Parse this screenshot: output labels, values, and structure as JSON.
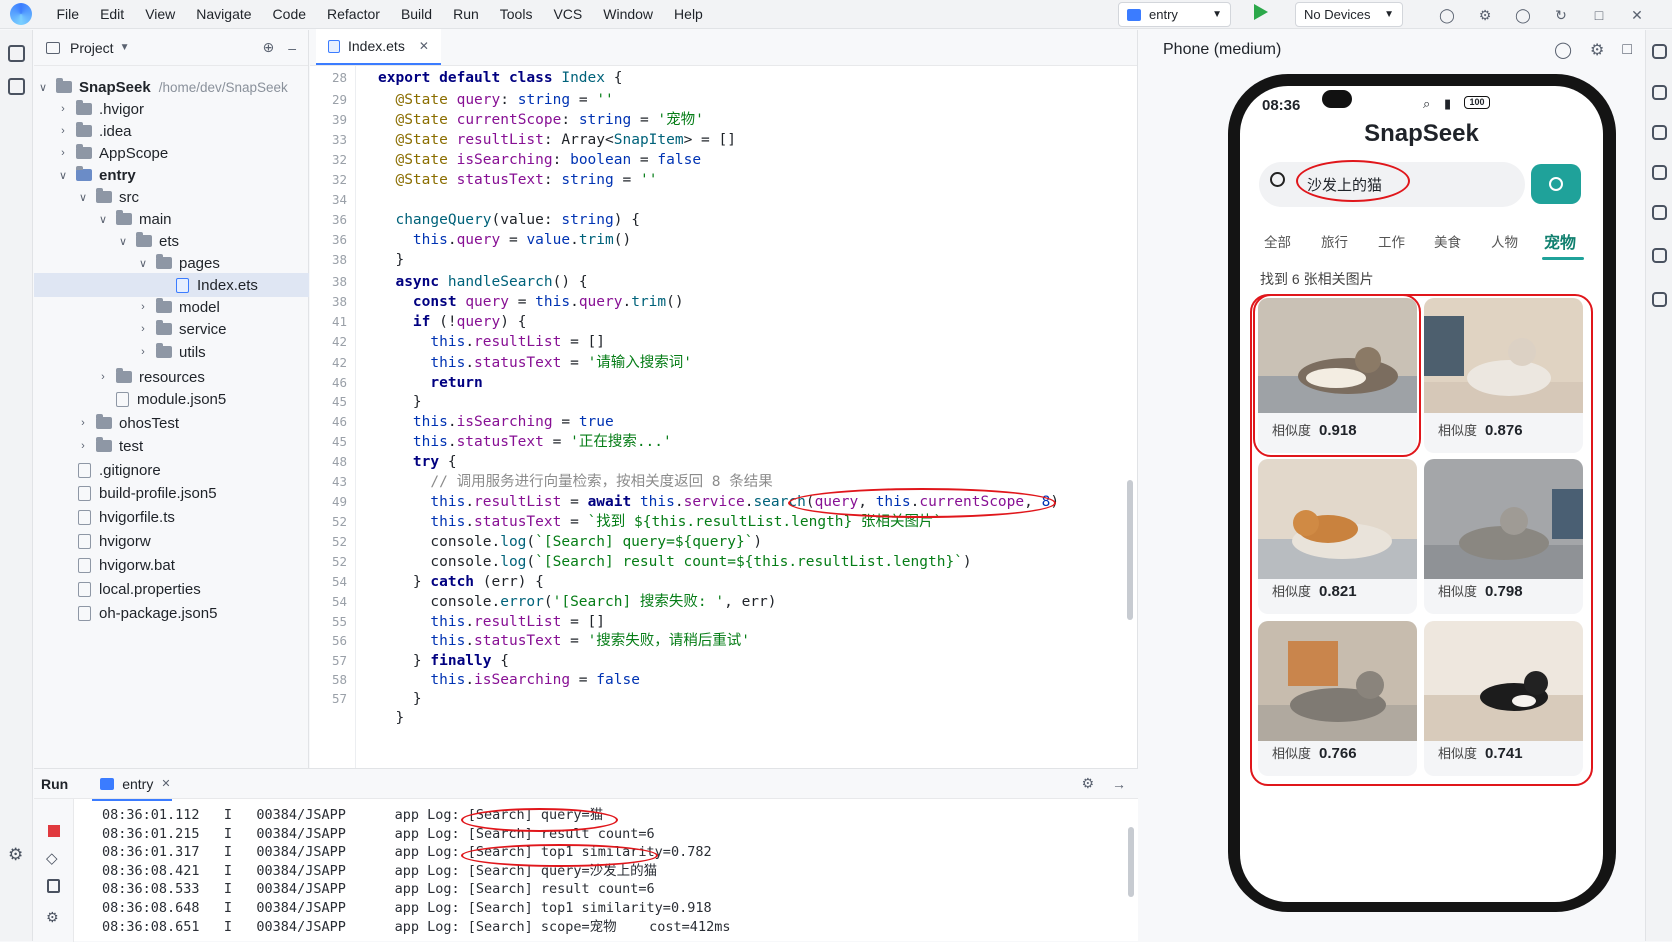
{
  "menu": [
    "File",
    "Edit",
    "View",
    "Navigate",
    "Code",
    "Refactor",
    "Build",
    "Run",
    "Tools",
    "VCS",
    "Window",
    "Help"
  ],
  "toolbar": {
    "run_config": "entry",
    "device": "No Devices"
  },
  "project": {
    "header": "Project",
    "root_name": "SnapSeek",
    "root_path": "/home/dev/SnapSeek",
    "items": [
      ".hvigor",
      ".idea",
      "AppScope",
      "entry",
      "src",
      "main",
      "ets",
      "pages",
      "Index.ets",
      "model",
      "service",
      "utils",
      "resources",
      "module.json5",
      "ohosTest",
      "test",
      ".gitignore",
      "build-profile.json5",
      "hvigorfile.ts",
      "hvigorw",
      "hvigorw.bat",
      "local.properties",
      "oh-package.json5"
    ]
  },
  "editor": {
    "tab": "Index.ets",
    "line_numbers": [
      "28",
      "29",
      "39",
      "33",
      "32",
      "32",
      "34",
      "36",
      "36",
      "38",
      "38",
      "38",
      "41",
      "42",
      "42",
      "46",
      "45",
      "46",
      "45",
      "48",
      "43",
      "49",
      "52",
      "52",
      "52",
      "54",
      "54",
      "55",
      "56",
      "57",
      "58",
      "57"
    ]
  },
  "run": {
    "title": "Run",
    "tab": "entry",
    "logs": [
      {
        "time": "08:36:01.112",
        "lvl": "I",
        "tag": "00384/JSAPP",
        "msg": "app Log: [Search] query=猫"
      },
      {
        "time": "08:36:01.215",
        "lvl": "I",
        "tag": "00384/JSAPP",
        "msg": "app Log: [Search] result count=6"
      },
      {
        "time": "08:36:01.317",
        "lvl": "I",
        "tag": "00384/JSAPP",
        "msg": "app Log: [Search] top1 similarity=0.782"
      },
      {
        "time": "08:36:08.421",
        "lvl": "I",
        "tag": "00384/JSAPP",
        "msg": "app Log: [Search] query=沙发上的猫"
      },
      {
        "time": "08:36:08.533",
        "lvl": "I",
        "tag": "00384/JSAPP",
        "msg": "app Log: [Search] result count=6"
      },
      {
        "time": "08:36:08.648",
        "lvl": "I",
        "tag": "00384/JSAPP",
        "msg": "app Log: [Search] top1 similarity=0.918"
      },
      {
        "time": "08:36:08.651",
        "lvl": "I",
        "tag": "00384/JSAPP",
        "msg": "app Log: [Search] scope=宠物    cost=412ms"
      }
    ]
  },
  "phone": {
    "pane_title": "Phone (medium)",
    "time": "08:36",
    "battery": "100",
    "app_title": "SnapSeek",
    "search_value": "沙发上的猫",
    "tabs": [
      "全部",
      "旅行",
      "工作",
      "美食",
      "人物",
      "宠物"
    ],
    "active_tab": "宠物",
    "result_text": "找到 6 张相关图片",
    "sim_label": "相似度",
    "results": [
      {
        "score": "0.918"
      },
      {
        "score": "0.876"
      },
      {
        "score": "0.821"
      },
      {
        "score": "0.798"
      },
      {
        "score": "0.766"
      },
      {
        "score": "0.741"
      }
    ]
  }
}
